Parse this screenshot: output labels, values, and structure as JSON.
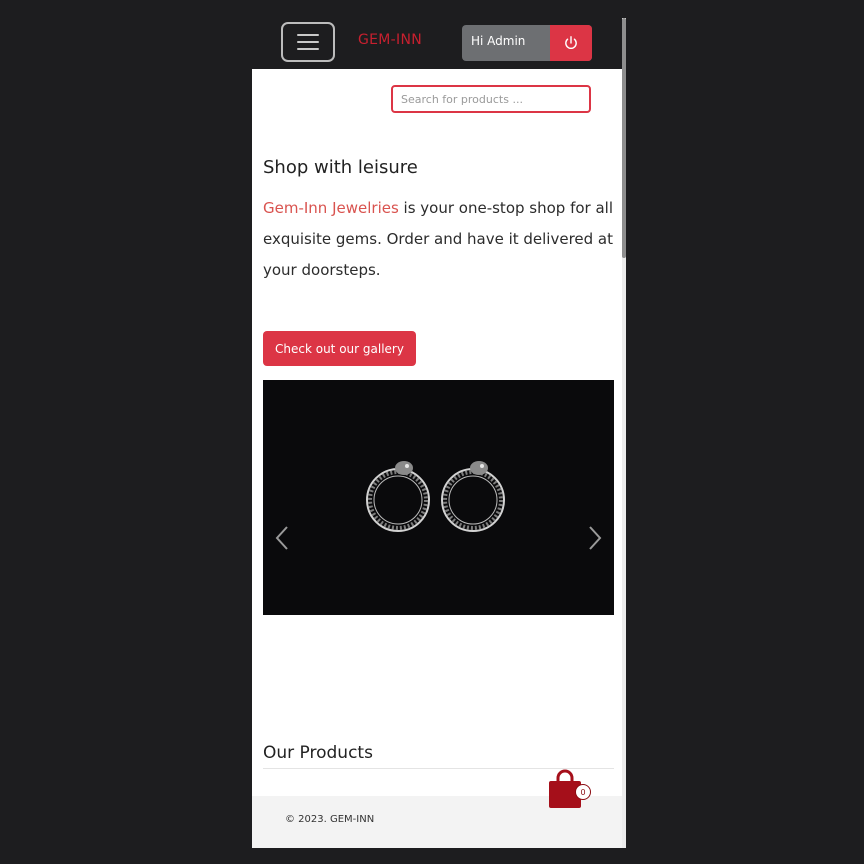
{
  "navbar": {
    "brand": "GEM-INN",
    "user_label": "Hi Admin",
    "menu_icon": "hamburger-icon",
    "logout_icon": "power-icon"
  },
  "search": {
    "placeholder": "Search for products ..."
  },
  "hero": {
    "title": "Shop with leisure",
    "brand_name": "Gem-Inn Jewelries",
    "description": " is your one-stop shop for all exquisite gems. Order and have it delivered at your doorsteps.",
    "button_label": "Check out our gallery"
  },
  "carousel": {
    "prev_icon": "chevron-left-icon",
    "next_icon": "chevron-right-icon"
  },
  "products": {
    "title": "Our Products"
  },
  "cart": {
    "icon": "shopping-bag-icon",
    "count": "0"
  },
  "footer": {
    "copyright": "© 2023. GEM-INN"
  },
  "colors": {
    "accent": "#dc3545",
    "brand": "#c7202f",
    "navbar": "#1d1d1f",
    "cart": "#a50f1a"
  }
}
